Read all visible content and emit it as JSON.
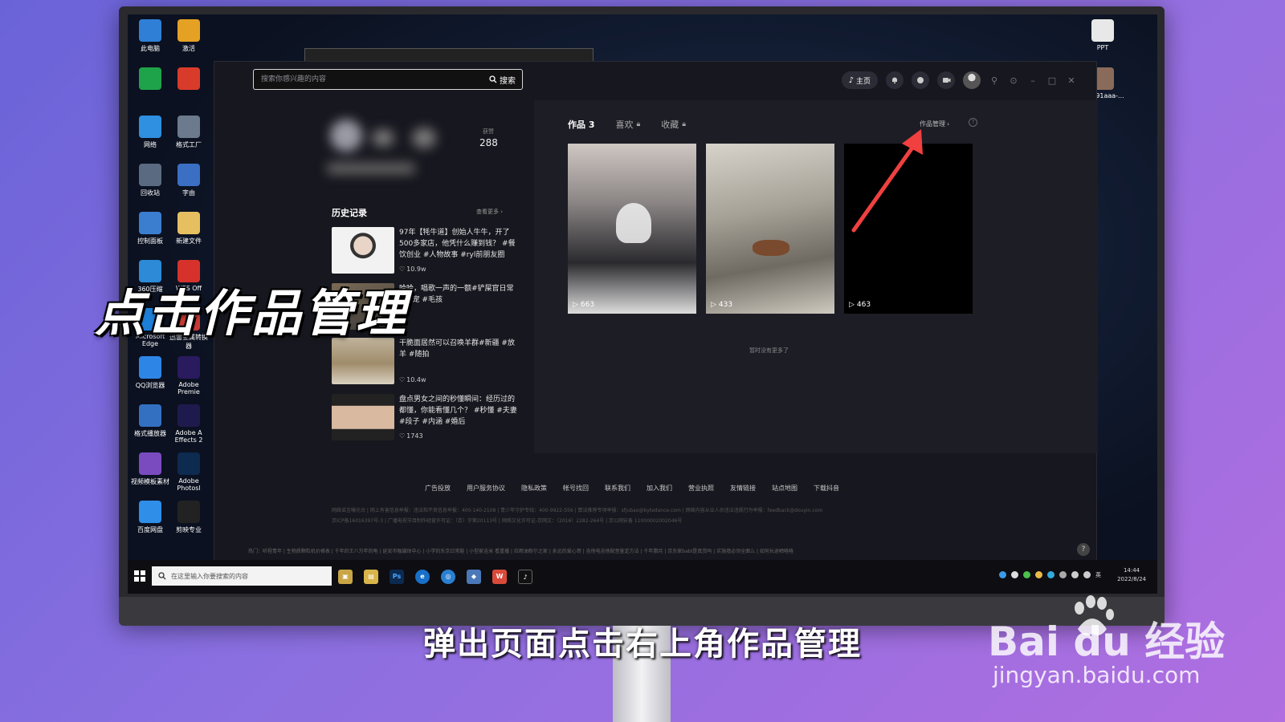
{
  "overlay": {
    "title": "点击作品管理",
    "subtitle": "弹出页面点击右上角作品管理",
    "watermark_main": "Bai du 经验",
    "watermark_sub": "jingyan.baidu.com"
  },
  "desktop_icons": [
    {
      "label": "此电脑",
      "color": "#2f7fd6"
    },
    {
      "label": "激活",
      "color": "#e5a123"
    },
    {
      "label": "",
      "color": "#1fa34a"
    },
    {
      "label": "",
      "color": "#d93b2b"
    },
    {
      "label": "网络",
      "color": "#2f8fe0"
    },
    {
      "label": "格式工厂",
      "color": "#6b7a8c"
    },
    {
      "label": "回收站",
      "color": "#5a6a80"
    },
    {
      "label": "字由",
      "color": "#3a6fc4"
    },
    {
      "label": "控制面板",
      "color": "#3b7ed0"
    },
    {
      "label": "新建文件",
      "color": "#e6c060"
    },
    {
      "label": "360压缩",
      "color": "#2c8ad6"
    },
    {
      "label": "WPS Off",
      "color": "#d6322b"
    },
    {
      "label": "Microsoft Edge",
      "color": "#1e7fd8"
    },
    {
      "label": "迅雷金属转换器",
      "color": "#c93a35"
    },
    {
      "label": "QQ浏览器",
      "color": "#2d86e6"
    },
    {
      "label": "Adobe Premie",
      "color": "#2a1a5e"
    },
    {
      "label": "格式播放器",
      "color": "#3470c2"
    },
    {
      "label": "Adobe A Effects 2",
      "color": "#1f1a4d"
    },
    {
      "label": "视频模板素材",
      "color": "#7a4bbf"
    },
    {
      "label": "Adobe Photosl",
      "color": "#0d2a4f"
    },
    {
      "label": "百度网盘",
      "color": "#2f8ee8"
    },
    {
      "label": "剪映专业",
      "color": "#222222"
    }
  ],
  "desktop_right_icons": [
    {
      "label": "PPT",
      "color": "#e8e8e8"
    },
    {
      "label": "56491aaa-...",
      "color": "#8a6a5a"
    }
  ],
  "app": {
    "search": {
      "placeholder": "搜索你感兴趣的内容",
      "button": "搜索"
    },
    "home_label": "主页",
    "profile": {
      "likes_label": "获赞",
      "likes_value": "288"
    },
    "history": {
      "title": "历史记录",
      "more": "查看更多",
      "items": [
        {
          "text": "97年【牦牛道】创始人牛牛，开了500多家店，他凭什么赚到钱？ #餐饮创业 #人物故事 #ryl前朋友圈",
          "likes": "10.9w"
        },
        {
          "text": "哈哈，唱歌一声的一额#铲屎官日常 #萌宠 #毛孩",
          "likes": ""
        },
        {
          "text": "干脆面居然可以召唤羊群#新疆 #放羊 #随拍",
          "likes": "10.4w"
        },
        {
          "text": "盘点男女之间的秒懂瞬间：经历过的都懂，你能看懂几个？ #秒懂 #夫妻 #段子 #内涵 #婚后",
          "likes": "1743"
        }
      ]
    },
    "tabs": [
      {
        "label": "作品 3",
        "locked": false
      },
      {
        "label": "喜欢",
        "locked": true
      },
      {
        "label": "收藏",
        "locked": true
      }
    ],
    "manage_label": "作品管理",
    "videos": [
      {
        "plays": "663"
      },
      {
        "plays": "433"
      },
      {
        "plays": "463"
      }
    ],
    "no_more": "暂时没有更多了",
    "footer_links": [
      "广告投放",
      "用户服务协议",
      "隐私政策",
      "帐号找回",
      "联系我们",
      "加入我们",
      "营业执照",
      "友情链接",
      "站点地图",
      "下载抖音"
    ],
    "footer_info_1": "网络谣言曝光台 | 网上有害信息举报：违法和不良信息举报：400-140-2108 | 青少年守护专线：400-9922-556 | 算法推荐专项举报：sfjubao@bytedance.com | 网络内容从业人员违法违规行为举报：feedback@douyin.com",
    "footer_info_2": "京ICP备16016397号-3 | 广播电视节目制作经营许可证：（京）字第20113号 | 网络文化许可证-京网文：（2016）2282-264号 | 京公网安备 11000002002046号",
    "hot_row": "热门：听程青年 | 生物质颗粒机价格表 | 千年的王八万年的龟 | 延安市融媒体中心 | 小学的东京日常鞋 | 小型家吉米 看重播 | 拉雨油粉尔之家 | 永远的爱心哥 | 吉他电吉他配音鉴定方法 | 千年腊月 | 京东家babl是真货吗 | 实施墙必须全面么 | 如何长途晒咯咯"
  },
  "taskbar": {
    "search_placeholder": "在这里输入你要搜索的内容",
    "time": "14:44",
    "date": "2022/8/24",
    "input_lang": "英"
  }
}
